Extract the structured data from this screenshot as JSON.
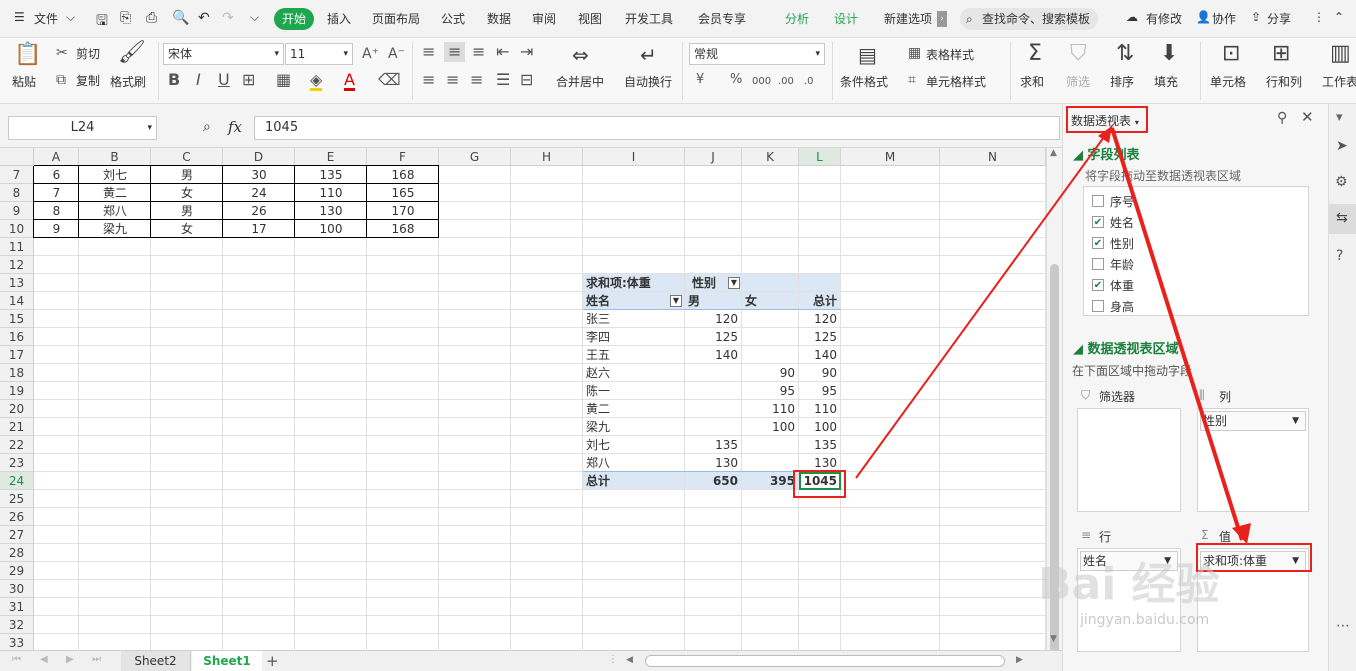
{
  "menu": {
    "file": "文件",
    "tabs": [
      "开始",
      "插入",
      "页面布局",
      "公式",
      "数据",
      "审阅",
      "视图",
      "开发工具",
      "会员专享",
      "分析",
      "设计",
      "新建选项"
    ],
    "search": "查找命令、搜索模板",
    "modified": "有修改",
    "collaborate": "协作",
    "share": "分享"
  },
  "ribbon": {
    "paste": "粘贴",
    "cut": "剪切",
    "copy": "复制",
    "format_painter": "格式刷",
    "font_name": "宋体",
    "font_size": "11",
    "merge_center": "合并居中",
    "wrap_text": "自动换行",
    "number_format": "常规",
    "cond_format": "条件格式",
    "table_style": "表格样式",
    "cell_style": "单元格样式",
    "sum": "求和",
    "filter": "筛选",
    "sort": "排序",
    "fill": "填充",
    "cell": "单元格",
    "row_col": "行和列",
    "worksheet": "工作表"
  },
  "formula_bar": {
    "name_box": "L24",
    "fx": "fx",
    "value": "1045"
  },
  "grid": {
    "columns": [
      "A",
      "B",
      "C",
      "D",
      "E",
      "F",
      "G",
      "H",
      "I",
      "J",
      "K",
      "L",
      "M",
      "N"
    ],
    "rows": [
      "7",
      "8",
      "9",
      "10",
      "11",
      "12",
      "13",
      "14",
      "15",
      "16",
      "17",
      "18",
      "19",
      "20",
      "21",
      "22",
      "23",
      "24",
      "25",
      "26",
      "27",
      "28",
      "29",
      "30",
      "31",
      "32",
      "33"
    ],
    "selected_column": "L",
    "selected_row": "24",
    "data_rows": [
      {
        "id": "6",
        "name": "刘七",
        "gender": "男",
        "age": "30",
        "weight": "135",
        "height": "168"
      },
      {
        "id": "7",
        "name": "黄二",
        "gender": "女",
        "age": "24",
        "weight": "110",
        "height": "165"
      },
      {
        "id": "8",
        "name": "郑八",
        "gender": "男",
        "age": "26",
        "weight": "130",
        "height": "170"
      },
      {
        "id": "9",
        "name": "梁九",
        "gender": "女",
        "age": "17",
        "weight": "100",
        "height": "168"
      }
    ]
  },
  "pivot": {
    "value_label": "求和项:体重",
    "col_field": "性别",
    "row_field": "姓名",
    "male": "男",
    "female": "女",
    "total_label": "总计",
    "rows": [
      {
        "name": "张三",
        "male": "120",
        "female": "",
        "total": "120"
      },
      {
        "name": "李四",
        "male": "125",
        "female": "",
        "total": "125"
      },
      {
        "name": "王五",
        "male": "140",
        "female": "",
        "total": "140"
      },
      {
        "name": "赵六",
        "male": "",
        "female": "90",
        "total": "90"
      },
      {
        "name": "陈一",
        "male": "",
        "female": "95",
        "total": "95"
      },
      {
        "name": "黄二",
        "male": "",
        "female": "110",
        "total": "110"
      },
      {
        "name": "梁九",
        "male": "",
        "female": "100",
        "total": "100"
      },
      {
        "name": "刘七",
        "male": "135",
        "female": "",
        "total": "135"
      },
      {
        "name": "郑八",
        "male": "130",
        "female": "",
        "total": "130"
      }
    ],
    "grand": {
      "male": "650",
      "female": "395",
      "total": "1045"
    }
  },
  "panel": {
    "title": "数据透视表",
    "field_list_title": "字段列表",
    "field_list_hint": "将字段拖动至数据透视表区域",
    "fields": [
      {
        "name": "序号",
        "checked": false
      },
      {
        "name": "姓名",
        "checked": true
      },
      {
        "name": "性别",
        "checked": true
      },
      {
        "name": "年龄",
        "checked": false
      },
      {
        "name": "体重",
        "checked": true
      },
      {
        "name": "身高",
        "checked": false
      }
    ],
    "area_title": "数据透视表区域",
    "area_hint": "在下面区域中拖动字段",
    "filter_label": "筛选器",
    "column_label": "列",
    "row_label": "行",
    "value_label": "值",
    "column_item": "性别",
    "row_item": "姓名",
    "value_item": "求和项:体重"
  },
  "sheets": {
    "tabs": [
      "Sheet2",
      "Sheet1"
    ],
    "active": "Sheet1"
  },
  "watermark": {
    "text": "Bai 经验",
    "url": "jingyan.baidu.com"
  },
  "colors": {
    "accent": "#1fa750",
    "highlight_red": "#e8211d",
    "pivot_header": "#dbe7f4"
  }
}
